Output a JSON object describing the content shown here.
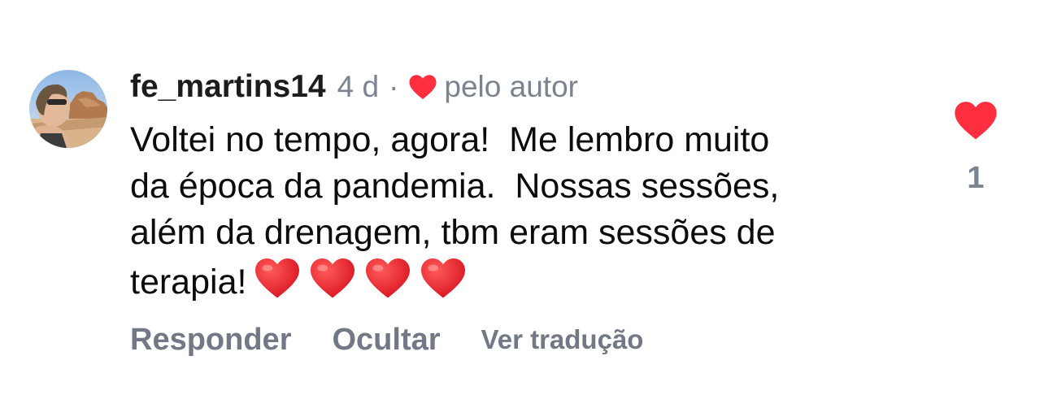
{
  "comment": {
    "username": "fe_martins14",
    "time": "4 d",
    "separator": "·",
    "liked_by_author_label": "pelo autor",
    "text_lines": [
      "Voltei no tempo, agora!  Me lembro muito",
      "da época da pandemia.  Nossas sessões,",
      "além da drenagem, tbm eram sessões de",
      "terapia!"
    ],
    "emoji_hearts": 4,
    "likes": "1",
    "actions": {
      "reply": "Responder",
      "hide": "Ocultar",
      "translate": "Ver tradução"
    }
  },
  "icons": {
    "author_heart": "heart-icon",
    "like": "heart-icon",
    "emoji": "red-heart-emoji"
  },
  "colors": {
    "heart_red": "#ff2f40",
    "secondary_text": "#7c8390",
    "primary_text": "#0c0c0c"
  }
}
